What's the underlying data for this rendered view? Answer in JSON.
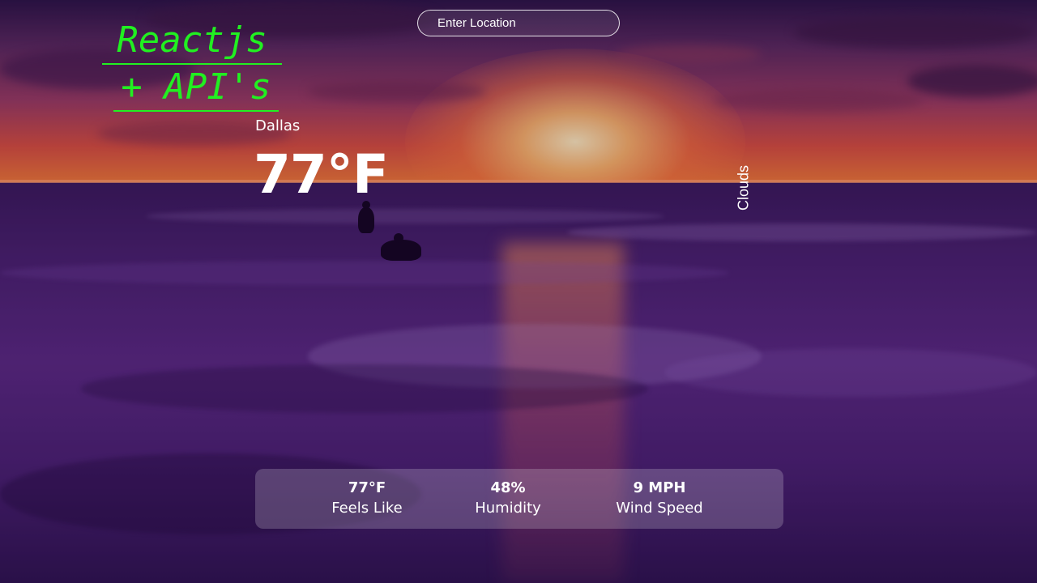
{
  "brand": {
    "line1": "Reactjs",
    "line2": "+ API's"
  },
  "search": {
    "placeholder": "Enter Location"
  },
  "weather": {
    "location": "Dallas",
    "temperature": "77°F",
    "condition": "Clouds"
  },
  "stats": {
    "feels_like": {
      "value": "77°F",
      "label": "Feels Like"
    },
    "humidity": {
      "value": "48%",
      "label": "Humidity"
    },
    "wind_speed": {
      "value": "9 MPH",
      "label": "Wind Speed"
    }
  },
  "colors": {
    "brand_text": "#21f021",
    "text": "#ffffff"
  }
}
